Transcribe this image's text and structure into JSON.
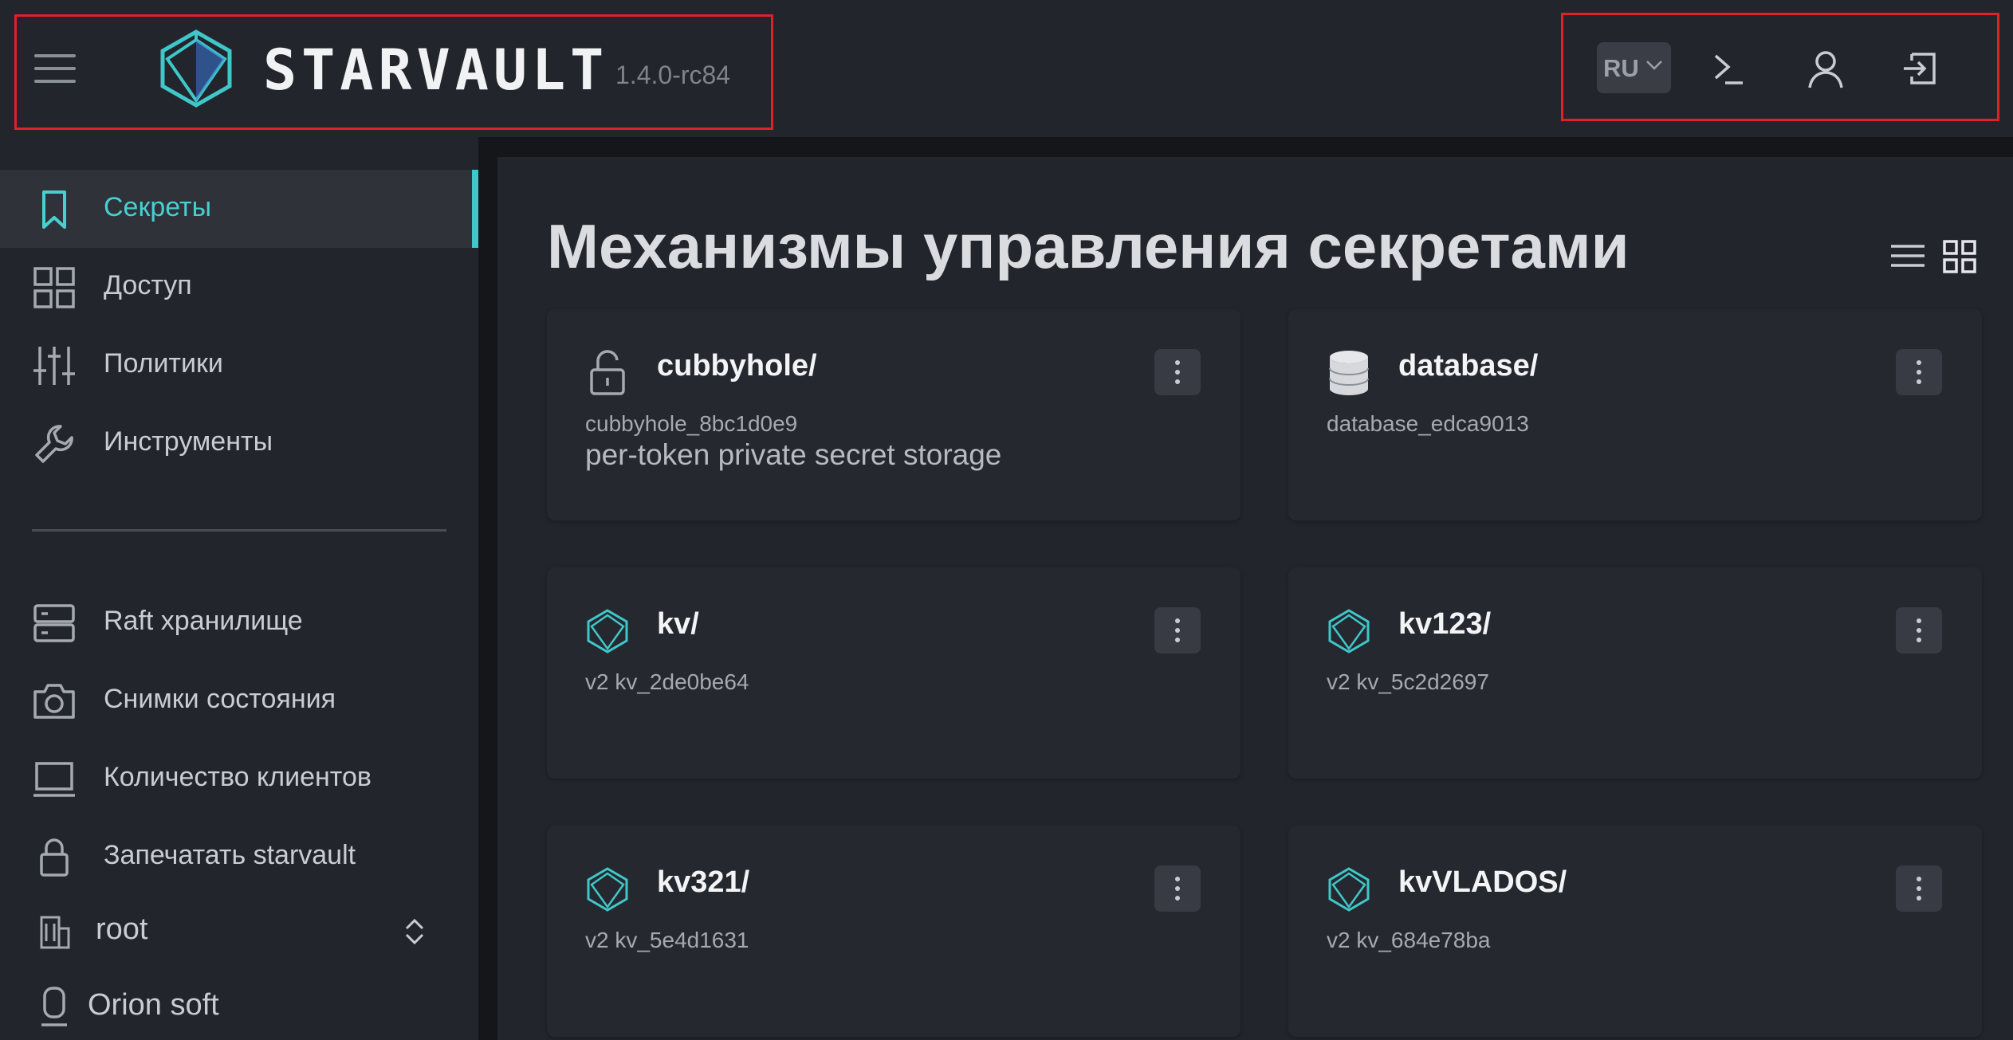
{
  "header": {
    "brand": "STARVAULT",
    "version": "1.4.0-rc84",
    "language": "RU",
    "icons": [
      "menu-icon",
      "logo-icon",
      "terminal-icon",
      "user-icon",
      "logout-icon"
    ]
  },
  "sidebar": {
    "items": [
      {
        "label": "Секреты",
        "icon": "bookmark-icon",
        "active": true
      },
      {
        "label": "Доступ",
        "icon": "grid-icon"
      },
      {
        "label": "Политики",
        "icon": "sliders-icon"
      },
      {
        "label": "Инструменты",
        "icon": "wrench-icon"
      }
    ],
    "system_items": [
      {
        "label": "Raft хранилище",
        "icon": "server-icon"
      },
      {
        "label": "Снимки состояния",
        "icon": "camera-icon"
      },
      {
        "label": "Количество клиентов",
        "icon": "laptop-icon"
      },
      {
        "label": "Запечатать starvault",
        "icon": "lock-icon"
      }
    ],
    "namespace": "root",
    "organization": "Orion soft"
  },
  "main": {
    "title": "Механизмы управления секретами",
    "engines": [
      {
        "name": "cubbyhole/",
        "accessor": "cubbyhole_8bc1d0e9",
        "description": "per-token private secret storage",
        "icon": "unlock-icon"
      },
      {
        "name": "database/",
        "accessor": "database_edca9013",
        "description": "",
        "icon": "database-icon"
      },
      {
        "name": "kv/",
        "accessor": "v2 kv_2de0be64",
        "description": "",
        "icon": "kv-icon"
      },
      {
        "name": "kv123/",
        "accessor": "v2 kv_5c2d2697",
        "description": "",
        "icon": "kv-icon"
      },
      {
        "name": "kv321/",
        "accessor": "v2 kv_5e4d1631",
        "description": "",
        "icon": "kv-icon"
      },
      {
        "name": "kvVLADOS/",
        "accessor": "v2 kv_684e78ba",
        "description": "",
        "icon": "kv-icon"
      }
    ]
  },
  "colors": {
    "accent": "#3fc7c9",
    "highlight_box": "#e0202b",
    "background": "#1b1d22",
    "panel": "#23252c"
  }
}
